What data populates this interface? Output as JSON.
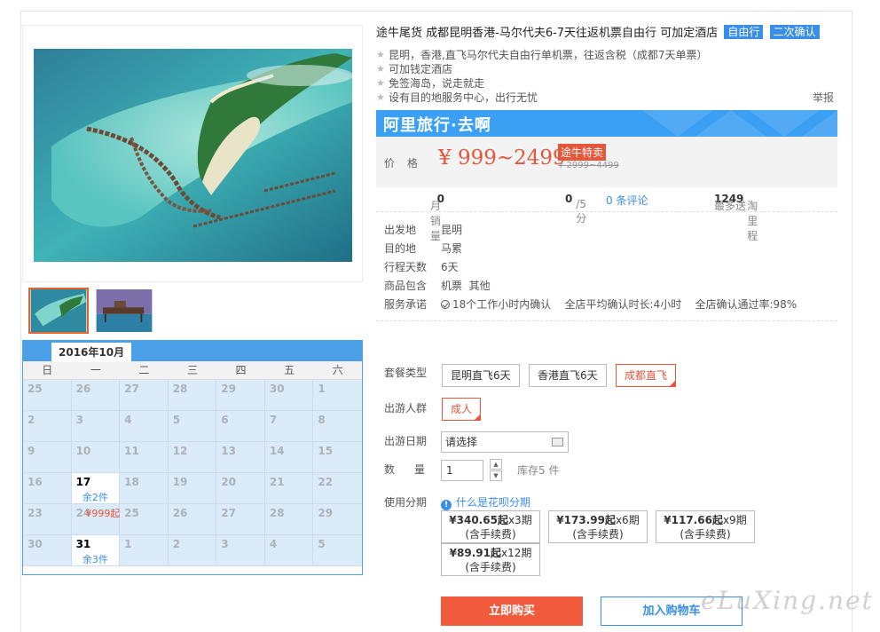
{
  "title": "途牛尾货 成都昆明香港-马尔代夫6-7天往返机票自由行 可加定酒店",
  "tags": [
    "自由行",
    "二次确认"
  ],
  "features": [
    "昆明，香港,直飞马尔代夫自由行单机票，往返含税（成都7天单票）",
    "可加钱定酒店",
    "免签海岛，说走就走",
    "设有目的地服务中心，出行无忧"
  ],
  "report": "举报",
  "ali_banner": "阿里旅行·去啊",
  "price": {
    "label": "价格",
    "value": "¥ 999~2499",
    "promo": "途牛特卖",
    "old": "¥ 2999~4499"
  },
  "stats": {
    "sales_label": "月销量",
    "sales_value": "0",
    "rating_value": "0",
    "rating_suffix": "/5分",
    "reviews": "0 条评论",
    "points_prefix": "最多送",
    "points_value": "1249",
    "points_suffix": "淘里程"
  },
  "info": [
    {
      "k": "出发地",
      "v": "昆明"
    },
    {
      "k": "目的地",
      "v": "马累"
    },
    {
      "k": "行程天数",
      "v": "6天"
    },
    {
      "k": "商品包含",
      "v": "机票  其他"
    },
    {
      "k": "服务承诺",
      "v": "18个工作小时内确认    全店平均确认时长:4小时    全店确认通过率:98%"
    }
  ],
  "package": {
    "label": "套餐类型",
    "options": [
      "昆明直飞6天",
      "香港直飞6天",
      "成都直飞"
    ],
    "selected": 2
  },
  "crowd": {
    "label": "出游人群",
    "option": "成人"
  },
  "date": {
    "label": "出游日期",
    "value": "请选择"
  },
  "quantity": {
    "label": "数量",
    "value": "1",
    "stock": "库存5 件"
  },
  "installment": {
    "label": "使用分期",
    "link": "什么是花呗分期",
    "options": [
      {
        "price": "¥340.65起",
        "term": "x3期",
        "fee": "(含手续费)"
      },
      {
        "price": "¥173.99起",
        "term": "x6期",
        "fee": "(含手续费)"
      },
      {
        "price": "¥117.66起",
        "term": "x9期",
        "fee": "(含手续费)"
      },
      {
        "price": "¥89.91起",
        "term": "x12期",
        "fee": "(含手续费)"
      }
    ]
  },
  "buttons": {
    "buy": "立即购买",
    "cart": "加入购物车"
  },
  "watermark": "eLuXing.net",
  "calendar": {
    "month": "2016年10月",
    "weekdays": [
      "日",
      "一",
      "二",
      "三",
      "四",
      "五",
      "六"
    ],
    "days": [
      {
        "d": "25"
      },
      {
        "d": "26"
      },
      {
        "d": "27"
      },
      {
        "d": "28"
      },
      {
        "d": "29"
      },
      {
        "d": "30"
      },
      {
        "d": "1"
      },
      {
        "d": "2"
      },
      {
        "d": "3"
      },
      {
        "d": "4"
      },
      {
        "d": "5"
      },
      {
        "d": "6"
      },
      {
        "d": "7"
      },
      {
        "d": "8"
      },
      {
        "d": "9"
      },
      {
        "d": "10"
      },
      {
        "d": "11"
      },
      {
        "d": "12"
      },
      {
        "d": "13"
      },
      {
        "d": "14"
      },
      {
        "d": "15"
      },
      {
        "d": "16"
      },
      {
        "d": "17",
        "avail": true,
        "stock": "余2件"
      },
      {
        "d": "18"
      },
      {
        "d": "19"
      },
      {
        "d": "20"
      },
      {
        "d": "21"
      },
      {
        "d": "22"
      },
      {
        "d": "23"
      },
      {
        "d": "24",
        "price": "¥999起"
      },
      {
        "d": "25"
      },
      {
        "d": "26"
      },
      {
        "d": "27"
      },
      {
        "d": "28"
      },
      {
        "d": "29"
      },
      {
        "d": "30"
      },
      {
        "d": "31",
        "avail": true,
        "stock": "余3件"
      },
      {
        "d": "1"
      },
      {
        "d": "2"
      },
      {
        "d": "3"
      },
      {
        "d": "4"
      },
      {
        "d": "5"
      }
    ]
  },
  "colors": {
    "accent": "#3a8ee6",
    "price": "#e5563b",
    "buy": "#f25a3c"
  }
}
